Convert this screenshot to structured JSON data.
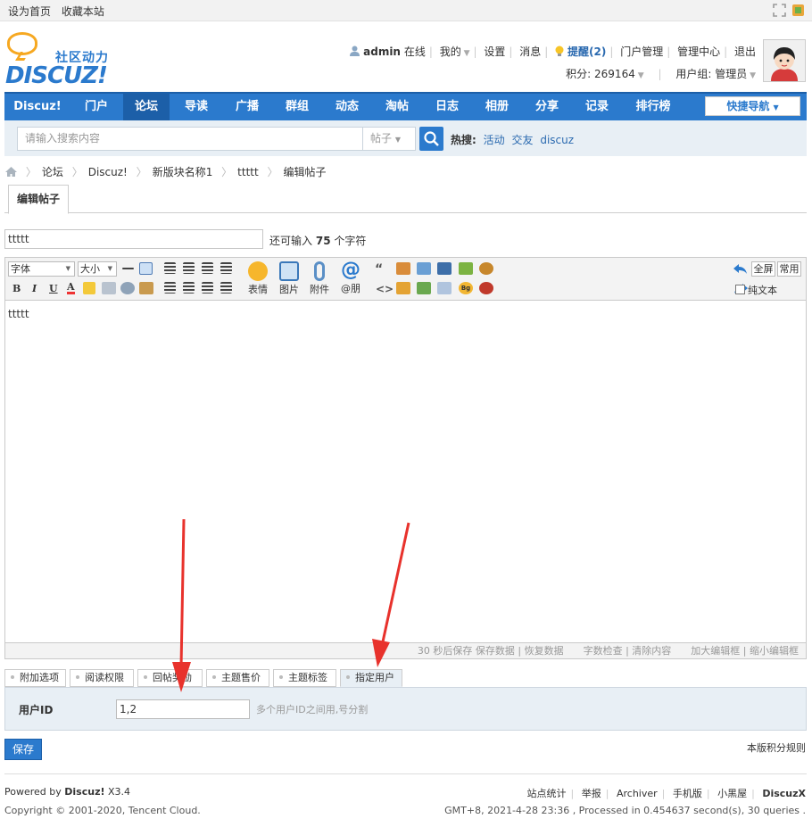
{
  "topbar": {
    "set_home": "设为首页",
    "bookmark": "收藏本站"
  },
  "logo": {
    "slogan": "社区动力",
    "brand": "DISCUZ!"
  },
  "user": {
    "name": "admin",
    "online": "在线",
    "mine": "我的",
    "settings": "设置",
    "messages": "消息",
    "reminder": "提醒(2)",
    "portal_admin": "门户管理",
    "admin_center": "管理中心",
    "logout": "退出",
    "credits": "积分: 269164",
    "group": "用户组: 管理员"
  },
  "nav": {
    "items": [
      "Discuz!",
      "门户",
      "论坛",
      "导读",
      "广播",
      "群组",
      "动态",
      "淘帖",
      "日志",
      "相册",
      "分享",
      "记录",
      "排行榜"
    ],
    "active_index": 2,
    "quick": "快捷导航"
  },
  "search": {
    "placeholder": "请输入搜索内容",
    "type": "帖子",
    "hot_label": "热搜:",
    "hot": [
      "活动",
      "交友",
      "discuz"
    ]
  },
  "breadcrumb": [
    "论坛",
    "Discuz!",
    "新版块名称1",
    "ttttt",
    "编辑帖子"
  ],
  "tab": "编辑帖子",
  "subject": {
    "value": "ttttt",
    "hint_prefix": "还可输入",
    "hint_count": "75",
    "hint_suffix": "个字符"
  },
  "toolbar": {
    "font": "字体",
    "size": "大小",
    "big": [
      "表情",
      "图片",
      "附件",
      "@朋"
    ],
    "fullscreen": "全屏",
    "common": "常用",
    "plaintext": "纯文本"
  },
  "editor": {
    "content": "ttttt"
  },
  "status": "30 秒后保存 保存数据 | 恢复数据　　字数检查 | 清除内容　　加大编辑框 | 缩小编辑框",
  "subtabs": [
    "附加选项",
    "阅读权限",
    "回帖奖励",
    "主题售价",
    "主题标签",
    "指定用户"
  ],
  "subtab_active": 5,
  "option": {
    "label": "用户ID",
    "value": "1,2",
    "hint": "多个用户ID之间用,号分割"
  },
  "save": "保存",
  "rules": "本版积分规则",
  "footer": {
    "powered_prefix": "Powered by",
    "powered_brand": "Discuz!",
    "powered_ver": "X3.4",
    "copyright": "Copyright © 2001-2020, Tencent Cloud.",
    "links": [
      "站点统计",
      "举报",
      "Archiver",
      "手机版",
      "小黑屋"
    ],
    "brand": "DiscuzX",
    "gmt": "GMT+8, 2021-4-28 23:36 , Processed in 0.454637 second(s), 30 queries ."
  },
  "colors": {
    "nav": "#2b7acd",
    "nav_active": "#1c5fa8",
    "arrow": "#e8322c",
    "link": "#2b6ab0"
  }
}
